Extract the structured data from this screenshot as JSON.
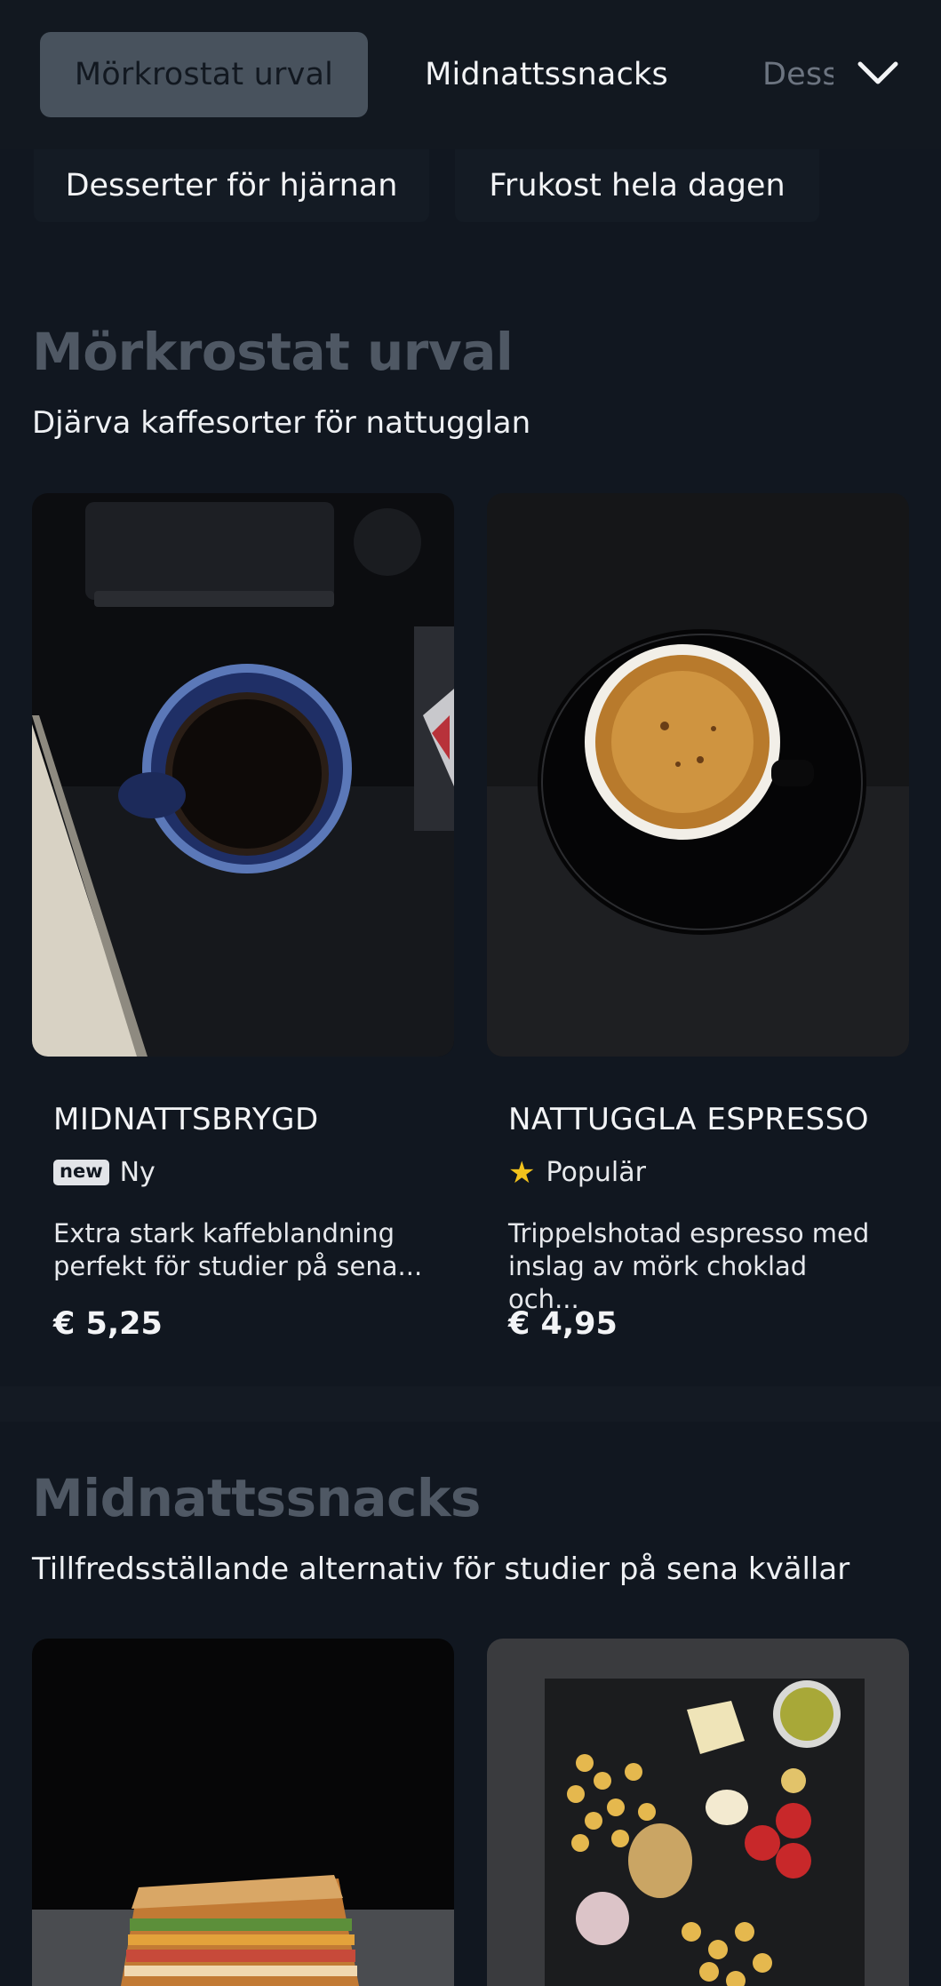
{
  "nav": {
    "tabs": [
      {
        "label": "Mörkrostat urval",
        "active": true
      },
      {
        "label": "Midnattssnacks",
        "active": false
      },
      {
        "label": "Desserter för hjärnan",
        "active": false
      }
    ],
    "tab_faded_label": "Dess",
    "expand_icon": "chevron-down-icon",
    "row2": [
      {
        "label": "Desserter för hjärnan"
      },
      {
        "label": "Frukost hela dagen"
      }
    ]
  },
  "sections": [
    {
      "title": "Mörkrostat urval",
      "subtitle": "Djärva kaffesorter för nattugglan",
      "items": [
        {
          "name": "MIDNATTSBRYGD",
          "badge_icon": "new",
          "badge_label": "Ny",
          "description_line1": "Extra stark kaffeblandning",
          "description_line2": "perfekt för studier på sena...",
          "price": "€ 5,25"
        },
        {
          "name": "NATTUGGLA ESPRESSO",
          "badge_icon": "★",
          "badge_label": "Populär",
          "description_line1": "Trippelshotad espresso med",
          "description_line2": "inslag av mörk choklad och...",
          "price": "€ 4,95"
        }
      ]
    },
    {
      "title": "Midnattssnacks",
      "subtitle": "Tillfredsställande alternativ för studier på sena kvällar",
      "items": [
        {
          "image": "grilled-sandwich-photo"
        },
        {
          "image": "snack-platter-photo"
        }
      ]
    }
  ],
  "colors": {
    "background": "#111720",
    "active_chip": "#48525d",
    "section_title": "#4f5864",
    "star": "#f3c31c"
  }
}
